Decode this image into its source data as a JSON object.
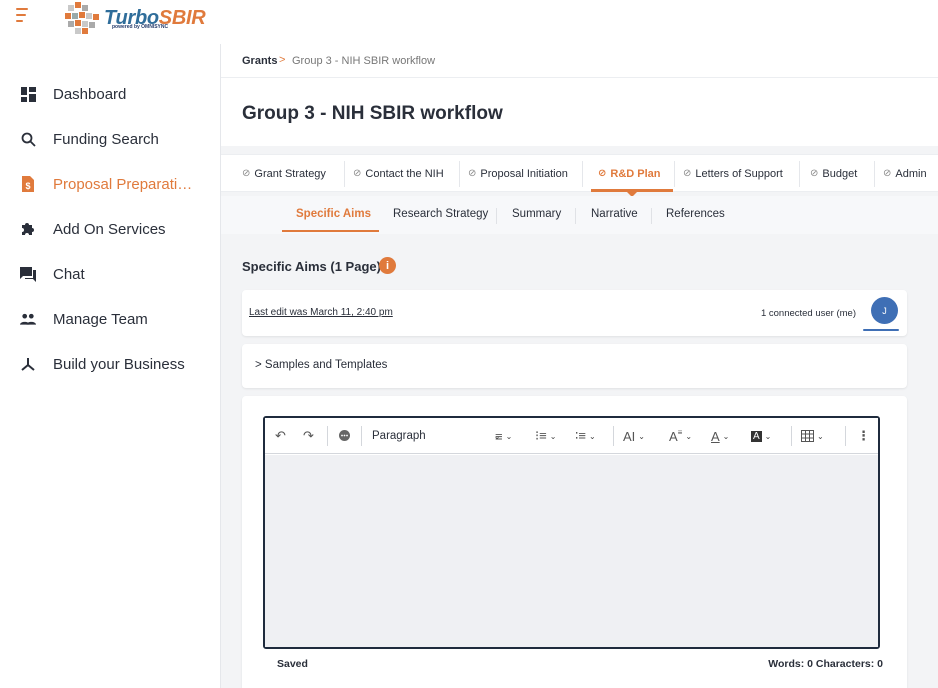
{
  "app": {
    "logo_text_main": "Turbo",
    "logo_text_accent": "SBIR",
    "logo_subtitle": "powered by OMNISYNC"
  },
  "sidebar": {
    "items": [
      {
        "label": "Dashboard",
        "icon": "dashboard-icon"
      },
      {
        "label": "Funding Search",
        "icon": "search-icon"
      },
      {
        "label": "Proposal Preparati…",
        "icon": "dollar-document-icon",
        "active": true
      },
      {
        "label": "Add On Services",
        "icon": "puzzle-icon"
      },
      {
        "label": "Chat",
        "icon": "chat-icon"
      },
      {
        "label": "Manage Team",
        "icon": "team-icon"
      },
      {
        "label": "Build your Business",
        "icon": "network-icon"
      }
    ]
  },
  "breadcrumb": {
    "root": "Grants",
    "separator": ">",
    "current": "Group 3 - NIH SBIR workflow"
  },
  "page": {
    "title": "Group 3 - NIH SBIR workflow"
  },
  "steps": [
    {
      "label": "Grant Strategy"
    },
    {
      "label": "Contact the NIH"
    },
    {
      "label": "Proposal Initiation"
    },
    {
      "label": "R&D Plan",
      "active": true
    },
    {
      "label": "Letters of Support"
    },
    {
      "label": "Budget"
    },
    {
      "label": "Admin"
    }
  ],
  "subtabs": [
    {
      "label": "Specific Aims",
      "active": true
    },
    {
      "label": "Research Strategy"
    },
    {
      "label": "Summary"
    },
    {
      "label": "Narrative"
    },
    {
      "label": "References"
    }
  ],
  "section": {
    "title": "Specific Aims (1 Page)",
    "info_icon": "i"
  },
  "edit_status": {
    "last_edit": "Last edit was March 11, 2:40 pm",
    "connected": "1 connected user (me)",
    "avatar_initial": "J"
  },
  "samples": {
    "label": "> Samples and Templates"
  },
  "editor": {
    "block_format": "Paragraph",
    "saved_label": "Saved",
    "counts": "Words: 0  Characters: 0"
  },
  "colors": {
    "accent": "#e07a3c",
    "brand_blue": "#2f6d9a",
    "avatar": "#3f6fb5"
  }
}
